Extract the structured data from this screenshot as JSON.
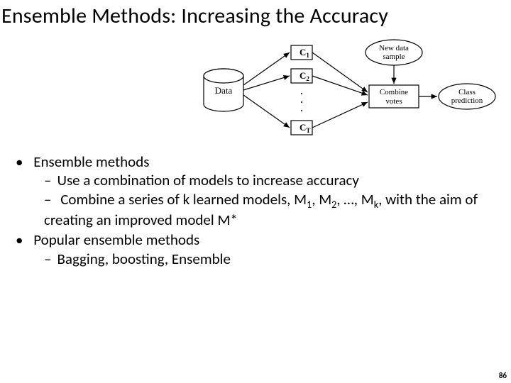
{
  "title": "Ensemble Methods: Increasing the Accuracy",
  "diagram": {
    "data_label": "Data",
    "classifiers": [
      "C",
      "C",
      "C"
    ],
    "classifier_subs": [
      "1",
      "2",
      "T"
    ],
    "new_sample": "New data sample",
    "combine": "Combine votes",
    "prediction": "Class prediction"
  },
  "bullets": {
    "b1": "Ensemble methods",
    "b1_1": "Use a combination of models to increase accuracy",
    "b1_2a": "Combine a series of k learned models, M",
    "b1_2b": ", M",
    "b1_2c": ", …, M",
    "b1_2d": ", with the aim of creating an improved model M*",
    "sub1": "1",
    "sub2": "2",
    "subk": "k",
    "b2": "Popular ensemble methods",
    "b2_1": "Bagging, boosting, Ensemble"
  },
  "page": "86"
}
